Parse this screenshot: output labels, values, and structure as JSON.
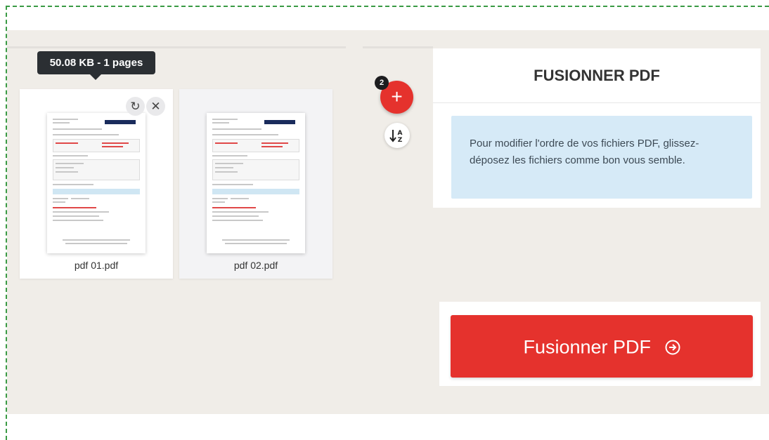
{
  "tooltip": {
    "text": "50.08 KB - 1 pages"
  },
  "files": [
    {
      "name": "pdf 01.pdf",
      "rotate_icon": "rotate-icon",
      "remove_icon": "close-icon"
    },
    {
      "name": "pdf 02.pdf"
    }
  ],
  "actions": {
    "add_badge": "2",
    "add_icon": "plus-icon",
    "sort_icon": "sort-az-icon"
  },
  "sidebar": {
    "title": "FUSIONNER PDF",
    "info": "Pour modifier l'ordre de vos fichiers PDF, glissez-déposez les fichiers comme bon vous semble."
  },
  "merge_button": {
    "label": "Fusionner PDF",
    "icon": "arrow-circle-right-icon"
  },
  "colors": {
    "accent": "#e5322d",
    "info_bg": "#d6eaf7",
    "workspace_bg": "#f0ede8",
    "tooltip_bg": "#2b2f33"
  }
}
